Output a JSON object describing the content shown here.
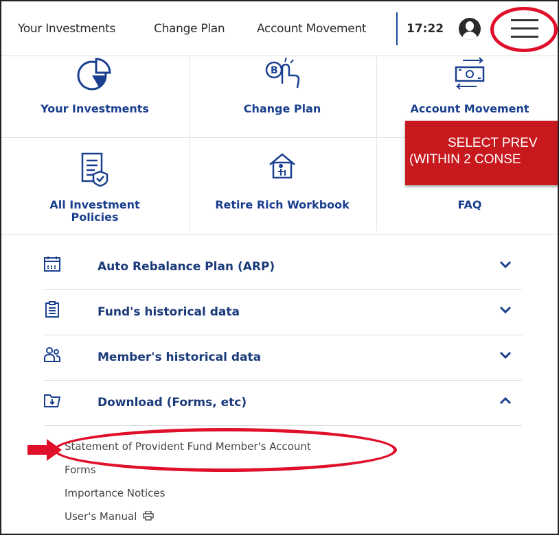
{
  "topbar": {
    "nav": [
      "Your Investments",
      "Change Plan",
      "Account Movement"
    ],
    "time": "17:22",
    "icons": {
      "avatar": "user-avatar-icon",
      "menu": "hamburger-menu-icon"
    }
  },
  "tiles": [
    {
      "label": "Your Investments",
      "icon": "pie-chart-icon"
    },
    {
      "label": "Change Plan",
      "icon": "hand-coin-icon"
    },
    {
      "label": "Account Movement",
      "icon": "money-transfer-icon"
    },
    {
      "label_line1": "All Investment",
      "label_line2": "Policies",
      "icon": "document-check-icon"
    },
    {
      "label": "Retire Rich Workbook",
      "icon": "house-person-icon"
    },
    {
      "label": "FAQ",
      "icon": "question-icon"
    }
  ],
  "banner": {
    "line1": "SELECT PREV",
    "line2": "(WITHIN 2 CONSE"
  },
  "accordion": [
    {
      "label": "Auto Rebalance Plan (ARP)",
      "icon": "calendar-icon",
      "state": "collapsed"
    },
    {
      "label": "Fund's historical data",
      "icon": "clipboard-icon",
      "state": "collapsed"
    },
    {
      "label": "Member's historical data",
      "icon": "members-icon",
      "state": "collapsed"
    },
    {
      "label": "Download (Forms, etc)",
      "icon": "folder-download-icon",
      "state": "expanded"
    }
  ],
  "downloads": [
    "Statement of Provident Fund Member's Account",
    "Forms",
    "Importance Notices",
    "User's Manual"
  ],
  "colors": {
    "brand": "#1a3f8f",
    "highlight": "#e0102a",
    "banner": "#c8191f"
  }
}
